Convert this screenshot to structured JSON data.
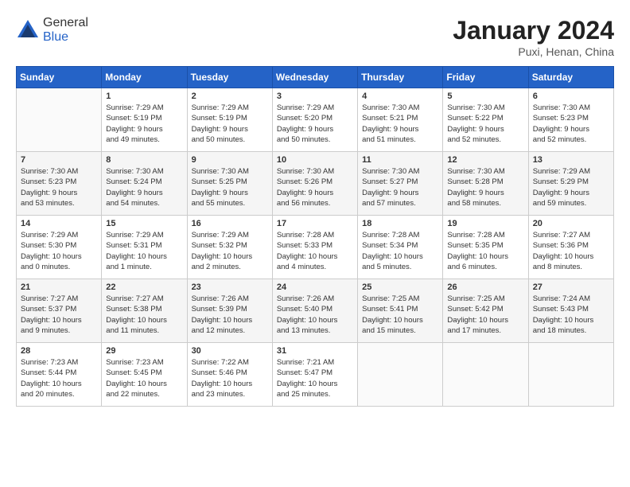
{
  "header": {
    "logo": {
      "general": "General",
      "blue": "Blue"
    },
    "title": "January 2024",
    "location": "Puxi, Henan, China"
  },
  "weekdays": [
    "Sunday",
    "Monday",
    "Tuesday",
    "Wednesday",
    "Thursday",
    "Friday",
    "Saturday"
  ],
  "weeks": [
    [
      {
        "day": "",
        "info": ""
      },
      {
        "day": "1",
        "info": "Sunrise: 7:29 AM\nSunset: 5:19 PM\nDaylight: 9 hours\nand 49 minutes."
      },
      {
        "day": "2",
        "info": "Sunrise: 7:29 AM\nSunset: 5:19 PM\nDaylight: 9 hours\nand 50 minutes."
      },
      {
        "day": "3",
        "info": "Sunrise: 7:29 AM\nSunset: 5:20 PM\nDaylight: 9 hours\nand 50 minutes."
      },
      {
        "day": "4",
        "info": "Sunrise: 7:30 AM\nSunset: 5:21 PM\nDaylight: 9 hours\nand 51 minutes."
      },
      {
        "day": "5",
        "info": "Sunrise: 7:30 AM\nSunset: 5:22 PM\nDaylight: 9 hours\nand 52 minutes."
      },
      {
        "day": "6",
        "info": "Sunrise: 7:30 AM\nSunset: 5:23 PM\nDaylight: 9 hours\nand 52 minutes."
      }
    ],
    [
      {
        "day": "7",
        "info": "Sunrise: 7:30 AM\nSunset: 5:23 PM\nDaylight: 9 hours\nand 53 minutes."
      },
      {
        "day": "8",
        "info": "Sunrise: 7:30 AM\nSunset: 5:24 PM\nDaylight: 9 hours\nand 54 minutes."
      },
      {
        "day": "9",
        "info": "Sunrise: 7:30 AM\nSunset: 5:25 PM\nDaylight: 9 hours\nand 55 minutes."
      },
      {
        "day": "10",
        "info": "Sunrise: 7:30 AM\nSunset: 5:26 PM\nDaylight: 9 hours\nand 56 minutes."
      },
      {
        "day": "11",
        "info": "Sunrise: 7:30 AM\nSunset: 5:27 PM\nDaylight: 9 hours\nand 57 minutes."
      },
      {
        "day": "12",
        "info": "Sunrise: 7:30 AM\nSunset: 5:28 PM\nDaylight: 9 hours\nand 58 minutes."
      },
      {
        "day": "13",
        "info": "Sunrise: 7:29 AM\nSunset: 5:29 PM\nDaylight: 9 hours\nand 59 minutes."
      }
    ],
    [
      {
        "day": "14",
        "info": "Sunrise: 7:29 AM\nSunset: 5:30 PM\nDaylight: 10 hours\nand 0 minutes."
      },
      {
        "day": "15",
        "info": "Sunrise: 7:29 AM\nSunset: 5:31 PM\nDaylight: 10 hours\nand 1 minute."
      },
      {
        "day": "16",
        "info": "Sunrise: 7:29 AM\nSunset: 5:32 PM\nDaylight: 10 hours\nand 2 minutes."
      },
      {
        "day": "17",
        "info": "Sunrise: 7:28 AM\nSunset: 5:33 PM\nDaylight: 10 hours\nand 4 minutes."
      },
      {
        "day": "18",
        "info": "Sunrise: 7:28 AM\nSunset: 5:34 PM\nDaylight: 10 hours\nand 5 minutes."
      },
      {
        "day": "19",
        "info": "Sunrise: 7:28 AM\nSunset: 5:35 PM\nDaylight: 10 hours\nand 6 minutes."
      },
      {
        "day": "20",
        "info": "Sunrise: 7:27 AM\nSunset: 5:36 PM\nDaylight: 10 hours\nand 8 minutes."
      }
    ],
    [
      {
        "day": "21",
        "info": "Sunrise: 7:27 AM\nSunset: 5:37 PM\nDaylight: 10 hours\nand 9 minutes."
      },
      {
        "day": "22",
        "info": "Sunrise: 7:27 AM\nSunset: 5:38 PM\nDaylight: 10 hours\nand 11 minutes."
      },
      {
        "day": "23",
        "info": "Sunrise: 7:26 AM\nSunset: 5:39 PM\nDaylight: 10 hours\nand 12 minutes."
      },
      {
        "day": "24",
        "info": "Sunrise: 7:26 AM\nSunset: 5:40 PM\nDaylight: 10 hours\nand 13 minutes."
      },
      {
        "day": "25",
        "info": "Sunrise: 7:25 AM\nSunset: 5:41 PM\nDaylight: 10 hours\nand 15 minutes."
      },
      {
        "day": "26",
        "info": "Sunrise: 7:25 AM\nSunset: 5:42 PM\nDaylight: 10 hours\nand 17 minutes."
      },
      {
        "day": "27",
        "info": "Sunrise: 7:24 AM\nSunset: 5:43 PM\nDaylight: 10 hours\nand 18 minutes."
      }
    ],
    [
      {
        "day": "28",
        "info": "Sunrise: 7:23 AM\nSunset: 5:44 PM\nDaylight: 10 hours\nand 20 minutes."
      },
      {
        "day": "29",
        "info": "Sunrise: 7:23 AM\nSunset: 5:45 PM\nDaylight: 10 hours\nand 22 minutes."
      },
      {
        "day": "30",
        "info": "Sunrise: 7:22 AM\nSunset: 5:46 PM\nDaylight: 10 hours\nand 23 minutes."
      },
      {
        "day": "31",
        "info": "Sunrise: 7:21 AM\nSunset: 5:47 PM\nDaylight: 10 hours\nand 25 minutes."
      },
      {
        "day": "",
        "info": ""
      },
      {
        "day": "",
        "info": ""
      },
      {
        "day": "",
        "info": ""
      }
    ]
  ]
}
